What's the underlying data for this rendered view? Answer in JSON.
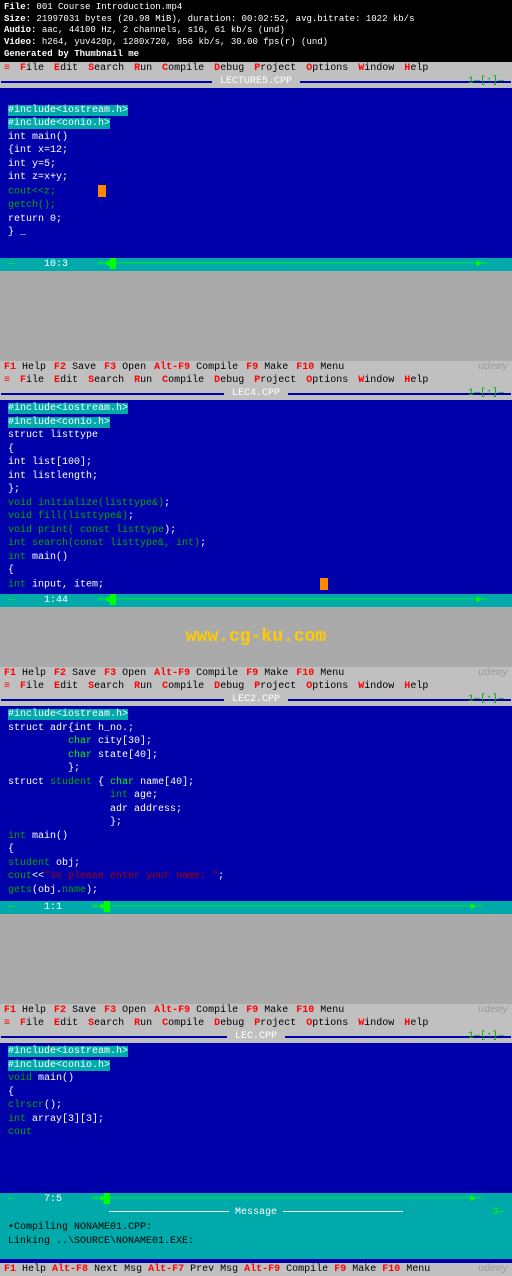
{
  "file_info": {
    "file_label": "File:",
    "file_value": "001 Course Introduction.mp4",
    "size_label": "Size:",
    "size_value": "21997031 bytes (20.98 MiB), duration: 00:02:52, avg.bitrate: 1022 kb/s",
    "audio_label": "Audio:",
    "audio_value": "aac, 44100 Hz, 2 channels, s16, 61 kb/s (und)",
    "video_label": "Video:",
    "video_value": "h264, yuv420p, 1280x720, 956 kb/s, 30.00 fps(r) (und)",
    "gen_label": "Generated by Thumbnail me"
  },
  "help_bar": {
    "f1": "F1",
    "f1_label": "Help",
    "f2": "F2",
    "f2_label": "Save",
    "f3": "F3",
    "f3_label": "Open",
    "altf9": "Alt-F9",
    "altf9_label": "Compile",
    "f9": "F9",
    "f9_label": "Make",
    "f10": "F10",
    "f10_label": "Menu",
    "watermark": "udemy"
  },
  "menu": {
    "dash": "≡",
    "items": [
      "File",
      "Edit",
      "Search",
      "Run",
      "Compile",
      "Debug",
      "Project",
      "Options",
      "Window",
      "Help"
    ]
  },
  "panel1": {
    "title": "LECTURE5.CPP",
    "ind": "1—[↑]—",
    "code": [
      {
        "t": "#include<iostream.h>",
        "c": "hl-inc"
      },
      {
        "t": "#include<conio.h>",
        "c": "hl-inc"
      },
      {
        "t": "int main()",
        "c": ""
      },
      {
        "t": "{int x=12;",
        "c": ""
      },
      {
        "t": "int y=5;",
        "c": ""
      },
      {
        "t": "int z=x+y;",
        "c": ""
      },
      {
        "t": "cout<<z;",
        "c": "kw-cout"
      },
      {
        "t": "getch();",
        "c": "kw-cout"
      },
      {
        "t": "return 0;",
        "c": ""
      },
      {
        "t": "} _",
        "c": ""
      }
    ],
    "status_pos": "10:3"
  },
  "panel2": {
    "title": "LEC4.CPP",
    "ind": "1—[↑]—",
    "code_html": "<span class='hl-inc'>#include&lt;iostream.h&gt;</span>\n<span class='hl-inc'>#include&lt;conio.h&gt;</span>\nstruct listtype\n{\nint list[100];\nint listlength;\n};\n<span class='kw-cout'>void</span> <span class='kw-func'>initialize(listtype&amp;)</span>;\n<span class='kw-cout'>void</span> <span class='kw-func'>fill(listtype&amp;)</span>;\n<span class='kw-cout'>void</span> <span class='kw-func'>print( const listtype</span>);\n<span class='kw-cout'>int</span> <span class='kw-func'>search(const listtype&amp;, int)</span>;\n<span class='kw-cout'>int</span> main()\n{\n<span class='kw-cout'>int</span> input, item;",
    "status_pos": "1:44"
  },
  "watermark_url": "www.cg-ku.com",
  "panel3": {
    "title": "LEC2.CPP",
    "ind": "1—[↑]—",
    "code_html": "<span class='hl-inc'>#include&lt;iostream.h&gt;</span>\nstruct adr{int h_no.;\n          <span class='kw-char'>char</span> city[30];\n          <span class='kw-char'>char</span> state[40];\n          };\nstruct <span class='kw-func'>student</span> { <span class='kw-char'>char</span> name[40];\n                 <span class='kw-cout'>int</span> age;\n                 adr address;\n                 };\n<span class='kw-cout'>int</span> main()\n{\n<span class='kw-func'>student</span> obj;\n<span class='kw-cout'>cout</span>&lt;&lt;<span class='kw-str'>\"so please enter your name: \"</span>;\n<span class='kw-cout'>gets</span>(obj.<span class='kw-cout'>name</span>);",
    "status_pos": "1:1"
  },
  "panel4": {
    "title": "LEC.CPP",
    "ind": "1—[↑]—",
    "code_html": "<span class='hl-inc'>#include&lt;iostream.h&gt;</span>\n<span class='hl-inc'>#include&lt;conio.h&gt;</span>\n<span class='kw-cout'>void</span> main()\n{\n<span class='kw-cout'>clrscr</span>();\n<span class='kw-cout'>int</span> array[3][3];\n<span class='kw-cout'>cout</span>",
    "status_pos": "7:5"
  },
  "message": {
    "title": "Message",
    "ind": "3—",
    "line1": "•Compiling NONAME01.CPP:",
    "line2": " Linking ..\\SOURCE\\NONAME01.EXE:"
  },
  "bottom_help": {
    "f1": "F1",
    "f1_label": "Help",
    "altf8": "Alt-F8",
    "altf8_label": "Next Msg",
    "altf7": "Alt-F7",
    "altf7_label": "Prev Msg",
    "altf9": "Alt-F9",
    "altf9_label": "Compile",
    "f9": "F9",
    "f9_label": "Make",
    "f10": "F10",
    "f10_label": "Menu"
  }
}
